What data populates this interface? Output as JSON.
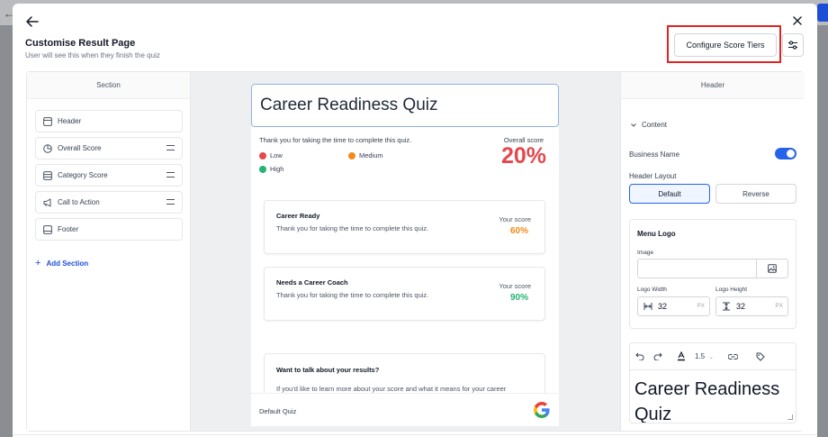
{
  "modal": {
    "title": "Customise Result Page",
    "subtitle": "User will see this when they finish the quiz",
    "configure_button": "Configure Score Tiers"
  },
  "left_panel": {
    "heading": "Section",
    "items": [
      {
        "label": "Header",
        "icon": "layout-icon",
        "draggable": false
      },
      {
        "label": "Overall Score",
        "icon": "pie-chart-icon",
        "draggable": true
      },
      {
        "label": "Category Score",
        "icon": "list-icon",
        "draggable": true
      },
      {
        "label": "Call to Action",
        "icon": "megaphone-icon",
        "draggable": true
      },
      {
        "label": "Footer",
        "icon": "footer-icon",
        "draggable": false
      }
    ],
    "add_section": "Add Section"
  },
  "preview": {
    "header_title": "Career Readiness Quiz",
    "thanks_text": "Thank you for taking the time to complete this quiz.",
    "legend": [
      {
        "label": "Low",
        "color": "#e5484d"
      },
      {
        "label": "Medium",
        "color": "#f08c1a"
      },
      {
        "label": "High",
        "color": "#22b573"
      }
    ],
    "overall_label": "Overall score",
    "overall_value": "20%",
    "cards": [
      {
        "title": "Career Ready",
        "text": "Thank you for taking the time to complete this quiz.",
        "score_label": "Your score",
        "score": "60%",
        "color": "#f08c1a"
      },
      {
        "title": "Needs a Career Coach",
        "text": "Thank you for taking the time to complete this quiz.",
        "score_label": "Your score",
        "score": "90%",
        "color": "#22b573"
      }
    ],
    "cta_title": "Want to talk about your results?",
    "cta_text": "If you'd like to learn more about your score and what it means for your career",
    "footer_text": "Default Quiz"
  },
  "right_panel": {
    "heading": "Header",
    "content_label": "Content",
    "business_name_label": "Business Name",
    "business_name_on": true,
    "header_layout_label": "Header Layout",
    "layout_options": [
      "Default",
      "Reverse"
    ],
    "layout_selected": "Default",
    "menu_logo": {
      "title": "Menu Logo",
      "image_label": "Image",
      "width_label": "Logo Width",
      "height_label": "Logo Height",
      "width_value": "32",
      "height_value": "32",
      "unit": "PX"
    },
    "editor": {
      "line_height": "1.5",
      "text": "Career Readiness Quiz"
    }
  },
  "colors": {
    "accent": "#2563eb",
    "highlight": "#e02424"
  }
}
